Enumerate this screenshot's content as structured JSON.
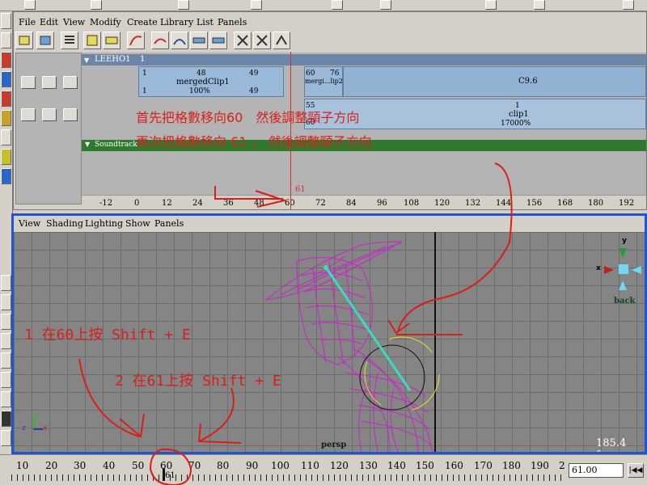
{
  "trax": {
    "menu": [
      "File",
      "Edit",
      "View",
      "Modify",
      "Create",
      "Library",
      "List",
      "Panels"
    ],
    "character_name": "LEEHO1",
    "character_start": "1",
    "merged_clip": {
      "start": "1",
      "mid": "48",
      "end": "49",
      "name": "mergedClip1",
      "bottom_start": "1",
      "scale": "100%",
      "bottom_end": "49"
    },
    "small_clip": {
      "start": "60",
      "end": "76",
      "name": "mergi...lip2"
    },
    "c96_label": "C9.6",
    "clip1": {
      "start": "55",
      "start2": "60",
      "index": "1",
      "name": "clip1",
      "scale": "17000%"
    },
    "sound_track": "Soundtrack",
    "playhead_label": "61",
    "ruler_ticks": [
      "-12",
      "0",
      "12",
      "24",
      "36",
      "48",
      "60",
      "72",
      "84",
      "96",
      "108",
      "120",
      "132",
      "144",
      "156",
      "168",
      "180",
      "192"
    ]
  },
  "annotations": {
    "line1": "首先把格數移向60　然後調整頸子方向",
    "line2": "再次把格數移向 61 ， 然後調整頸子方向",
    "step1": "1 在60上按 Shift + E",
    "step2": "2 在61上按 Shift + E"
  },
  "viewport": {
    "menu": [
      "View",
      "Shading",
      "Lighting",
      "Show",
      "Panels"
    ],
    "camera_label": "persp",
    "fps": "185.4 fps",
    "view_cube_label": "back",
    "axis_x": "x",
    "axis_y": "y",
    "axis_z": "z"
  },
  "time_slider": {
    "ticks": [
      "10",
      "20",
      "30",
      "40",
      "50",
      "60",
      "70",
      "80",
      "90",
      "100",
      "110",
      "120",
      "130",
      "140",
      "150",
      "160",
      "170",
      "180",
      "190",
      "2"
    ],
    "current_marker": "61",
    "current_time": "61.00"
  },
  "colors": {
    "annotation_red": "#d8201a",
    "wireframe_magenta": "#cc22cc",
    "viewport_border": "#2255cc"
  }
}
